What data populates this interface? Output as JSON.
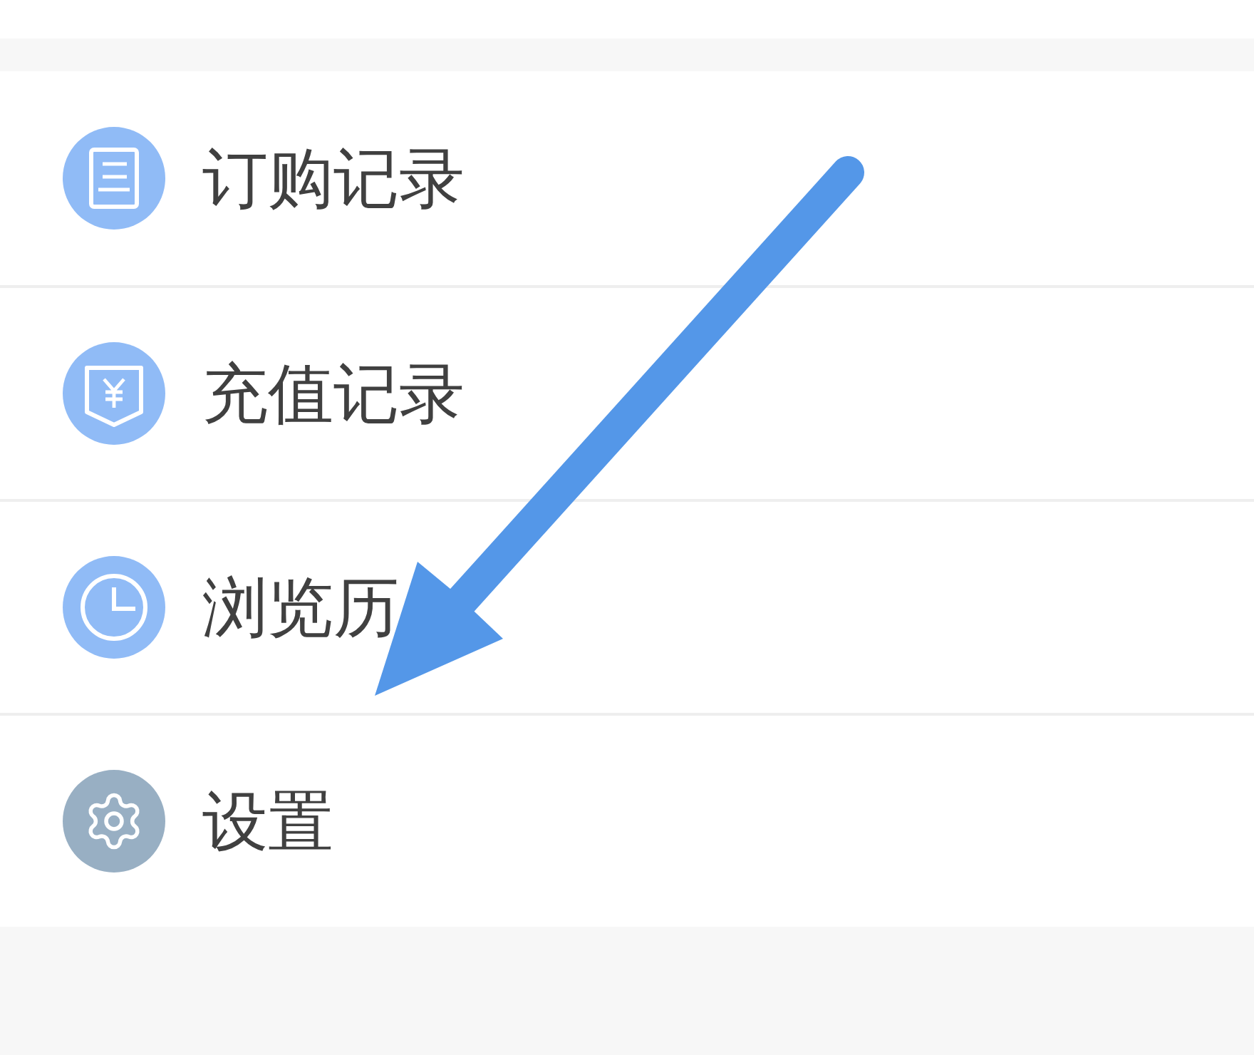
{
  "menu": {
    "items": [
      {
        "kind": "orders",
        "label": "订购记录"
      },
      {
        "kind": "recharge",
        "label": "充值记录"
      },
      {
        "kind": "history",
        "label": "浏览历"
      },
      {
        "kind": "settings",
        "label": "设置"
      }
    ]
  }
}
